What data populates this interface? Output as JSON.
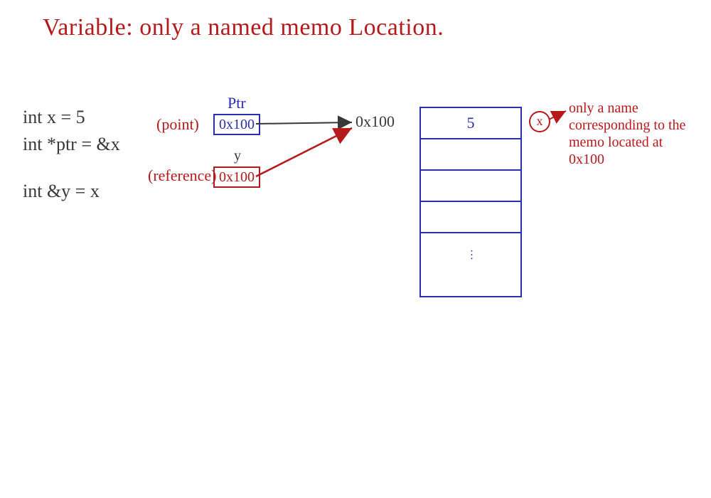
{
  "title": "Variable: only a named memo Location.",
  "code": {
    "line1": "int x = 5",
    "line2": "int *ptr = &x",
    "line3": "int &y = x"
  },
  "ptr": {
    "label_top": "Ptr",
    "role": "(point)",
    "value": "0x100"
  },
  "ref": {
    "label_top": "y",
    "role": "(reference)",
    "value": "0x100"
  },
  "address_text": "0x100",
  "memory": {
    "cell0": "5",
    "cell1": "",
    "cell2": "",
    "cell3": "",
    "cell4": ""
  },
  "x_marker": "x",
  "annotation": {
    "l1": "only a name",
    "l2": "corresponding to the",
    "l3": "memo located at",
    "l4": "0x100"
  }
}
